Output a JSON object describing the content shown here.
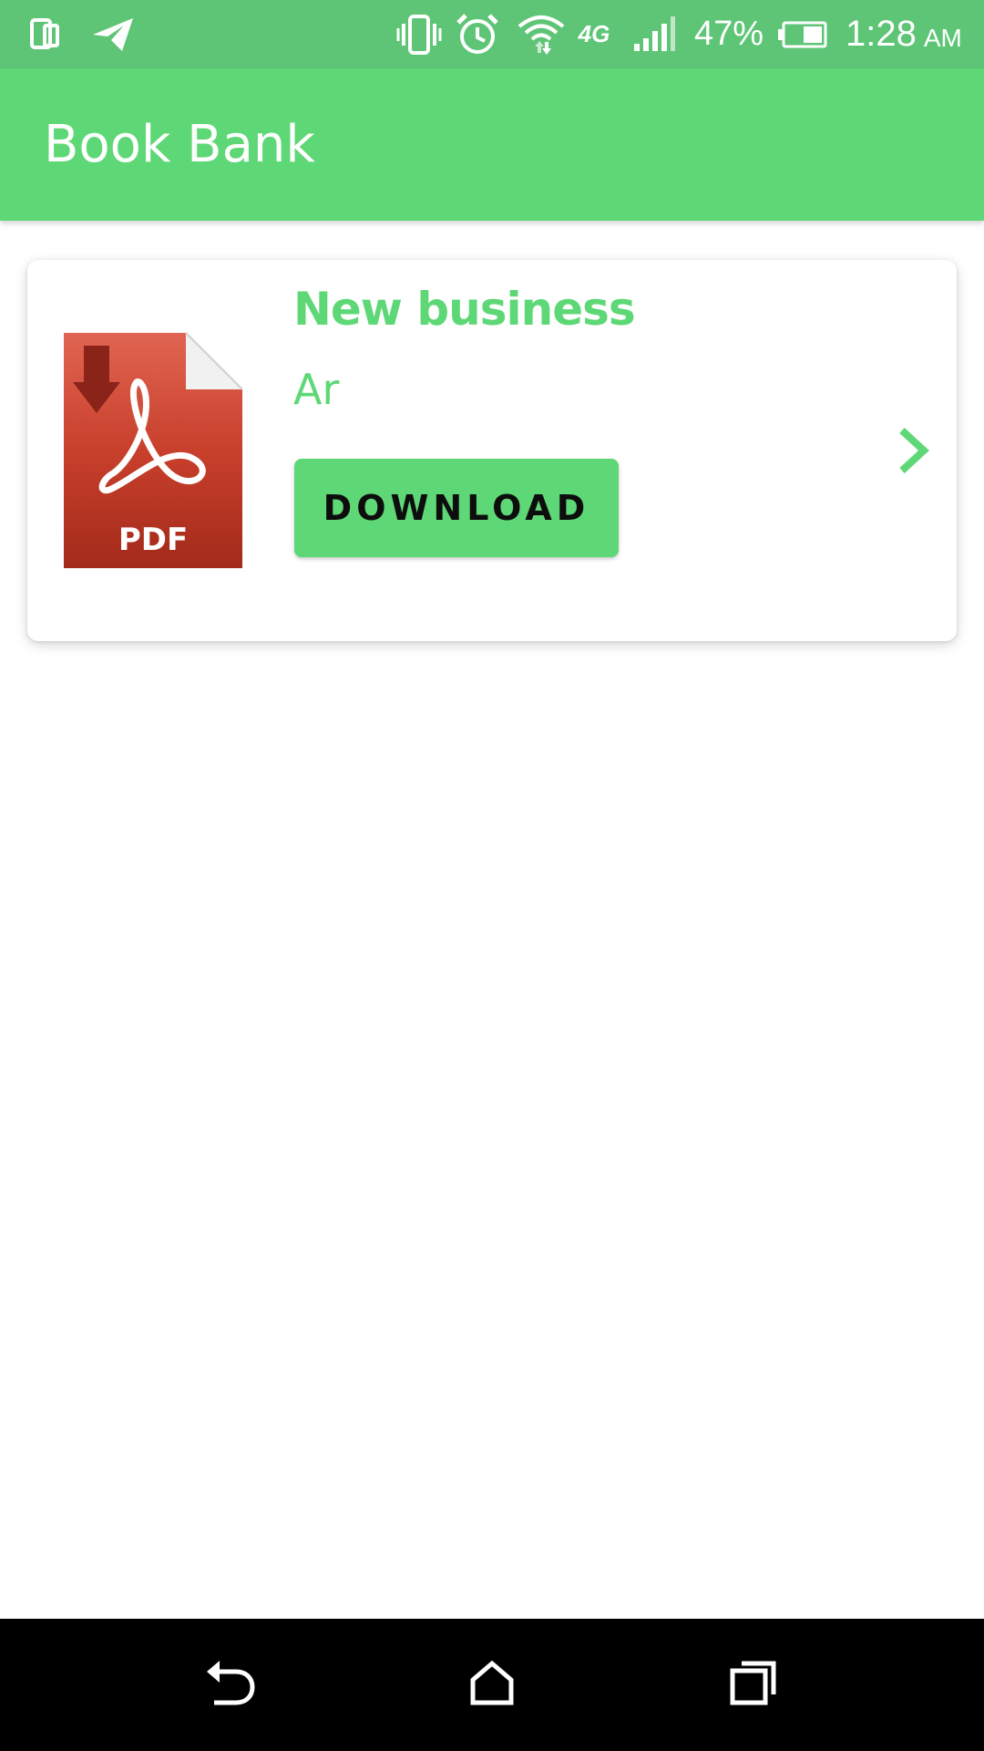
{
  "status_bar": {
    "battery_percent": "47%",
    "time": "1:28",
    "am_pm": "AM",
    "network": "4G",
    "icons": [
      "dual-sim-icon",
      "telegram-icon",
      "vibrate-icon",
      "alarm-icon",
      "wifi-icon",
      "signal-icon",
      "battery-icon"
    ]
  },
  "app_bar": {
    "title": "Book Bank"
  },
  "books": [
    {
      "title": "New business",
      "author": "Ar",
      "download_label": "DOWNLOAD",
      "file_type": "PDF",
      "thumbnail_icon": "pdf-file-icon"
    }
  ],
  "nav_bar": {
    "buttons": [
      "back-icon",
      "home-icon",
      "recents-icon"
    ]
  },
  "colors": {
    "status_bar": "#5ec576",
    "accent": "#5ed876",
    "pdf_red": "#c23a28",
    "nav_bar": "#000000"
  }
}
